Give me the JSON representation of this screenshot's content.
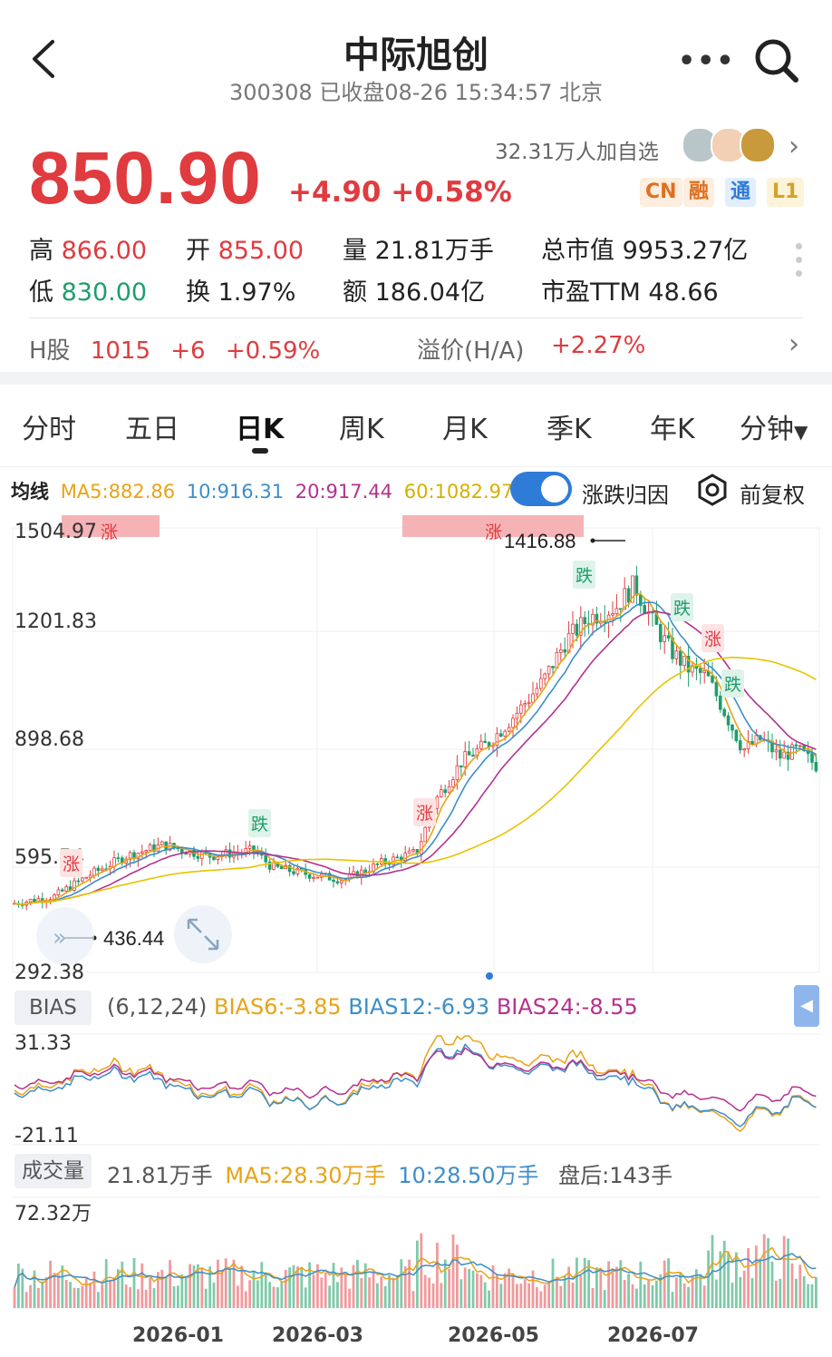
{
  "header": {
    "title": "中际旭创",
    "subtitle": "300308 已收盘08-26 15:34:57 北京"
  },
  "quote": {
    "price": "850.90",
    "change": "+4.90 +0.58%",
    "followers": "32.31万人加自选",
    "badges": [
      "CN",
      "融",
      "通",
      "L1"
    ]
  },
  "stats": {
    "high_label": "高",
    "high_value": "866.00",
    "open_label": "开",
    "open_value": "855.00",
    "volume_label": "量",
    "volume_value": "21.81万手",
    "mktcap_label": "总市值",
    "mktcap_value": "9953.27亿",
    "low_label": "低",
    "low_value": "830.00",
    "turnover_label": "换",
    "turnover_value": "1.97%",
    "amount_label": "额",
    "amount_value": "186.04亿",
    "pe_label": "市盈TTM",
    "pe_value": "48.66"
  },
  "hshare": {
    "label": "H股",
    "price": "1015",
    "change": "+6",
    "pct": "+0.59%",
    "premium_label": "溢价(H/A)",
    "premium_value": "+2.27%"
  },
  "tabs": [
    {
      "label": "分时"
    },
    {
      "label": "五日"
    },
    {
      "label": "日K"
    },
    {
      "label": "周K"
    },
    {
      "label": "月K"
    },
    {
      "label": "季K"
    },
    {
      "label": "年K"
    },
    {
      "label": "分钟"
    }
  ],
  "ma_row": {
    "label": "均线",
    "ma5": "MA5:882.86",
    "ma10": "10:916.31",
    "ma20": "20:917.44",
    "ma60": "60:1082.97",
    "toggle_label": "涨跌归因",
    "adjust_label": "前复权"
  },
  "colors": {
    "up": "#e03b3f",
    "down": "#1f9e6b",
    "ma5": "#e8a317",
    "ma10": "#3d8ec9",
    "ma20": "#b5318f",
    "ma60": "#e6c400"
  },
  "kline": {
    "y_labels": [
      "1504.97",
      "1201.83",
      "898.68",
      "595.54",
      "292.38"
    ],
    "high_mark": "1416.88",
    "low_mark": "436.44",
    "marks": [
      "涨",
      "涨",
      "跌",
      "涨",
      "跌",
      "跌",
      "涨",
      "跌"
    ]
  },
  "bias": {
    "label": "BIAS",
    "params": "(6,12,24)",
    "b6": "BIAS6:-3.85",
    "b12": "BIAS12:-6.93",
    "b24": "BIAS24:-8.55",
    "y_top": "31.33",
    "y_bottom": "-21.11"
  },
  "volume": {
    "label": "成交量",
    "value": "21.81万手",
    "ma5": "MA5:28.30万手",
    "ma10": "10:28.50万手",
    "after": "盘后:143手",
    "y_top": "72.32万"
  },
  "x_axis": [
    "2026-01",
    "2026-03",
    "2026-05",
    "2026-07"
  ],
  "chart_data": {
    "type": "candlestick",
    "y_range": [
      292.38,
      1504.97
    ],
    "period_high": 1416.88,
    "period_low": 436.44,
    "x_labels": [
      "2026-01",
      "2026-03",
      "2026-05",
      "2026-07"
    ],
    "series": [
      {
        "name": "MA5",
        "value": 882.86
      },
      {
        "name": "10",
        "value": 916.31
      },
      {
        "name": "20",
        "value": 917.44
      },
      {
        "name": "60",
        "value": 1082.97
      }
    ]
  }
}
